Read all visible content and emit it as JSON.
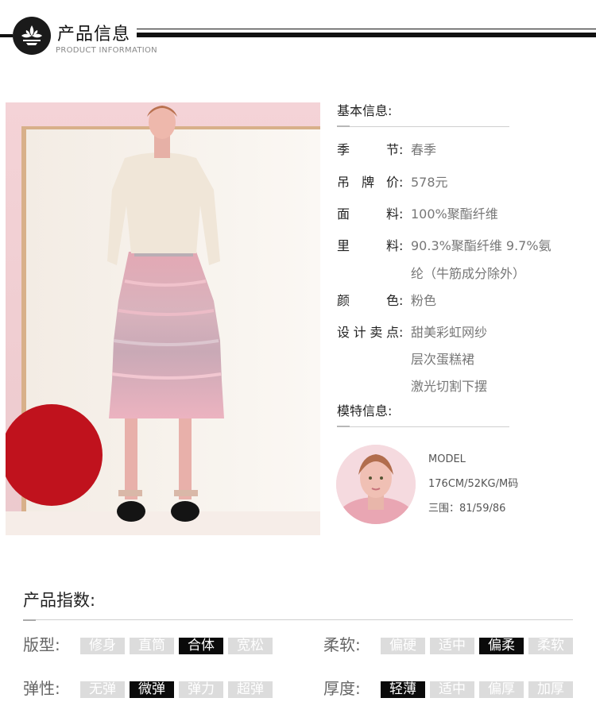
{
  "header": {
    "title": "产品信息",
    "subtitle": "PRODUCT INFORMATION"
  },
  "basic": {
    "title": "基本信息:",
    "rows": [
      {
        "label": "季节",
        "values": [
          "春季"
        ]
      },
      {
        "label": "吊牌价",
        "values": [
          "578元"
        ]
      },
      {
        "label": "面料",
        "values": [
          "100%聚酯纤维"
        ]
      },
      {
        "label": "里料",
        "values": [
          "90.3%聚酯纤维 9.7%氨",
          "纶（牛筋成分除外）"
        ]
      },
      {
        "label": "颜色",
        "values": [
          "粉色"
        ]
      },
      {
        "label": "设计卖点",
        "values": [
          "甜美彩虹网纱",
          "层次蛋糕裙",
          "激光切割下摆"
        ]
      }
    ],
    "colon": ":"
  },
  "model": {
    "title": "模特信息:",
    "lines": [
      "MODEL",
      "176CM/52KG/M码",
      "三围：81/59/86"
    ]
  },
  "index": {
    "title": "产品指数:",
    "groups": [
      {
        "label": "版型:",
        "options": [
          "修身",
          "直筒",
          "合体",
          "宽松"
        ],
        "selected": 2
      },
      {
        "label": "柔软:",
        "options": [
          "偏硬",
          "适中",
          "偏柔",
          "柔软"
        ],
        "selected": 2
      },
      {
        "label": "弹性:",
        "options": [
          "无弹",
          "微弹",
          "弹力",
          "超弹"
        ],
        "selected": 1
      },
      {
        "label": "厚度:",
        "options": [
          "轻薄",
          "适中",
          "偏厚",
          "加厚"
        ],
        "selected": 0
      }
    ]
  },
  "colors": {
    "accent": "#0a0a0a",
    "chip_off": "#dcdcdc",
    "photo_bg": "#f1d3d8"
  }
}
